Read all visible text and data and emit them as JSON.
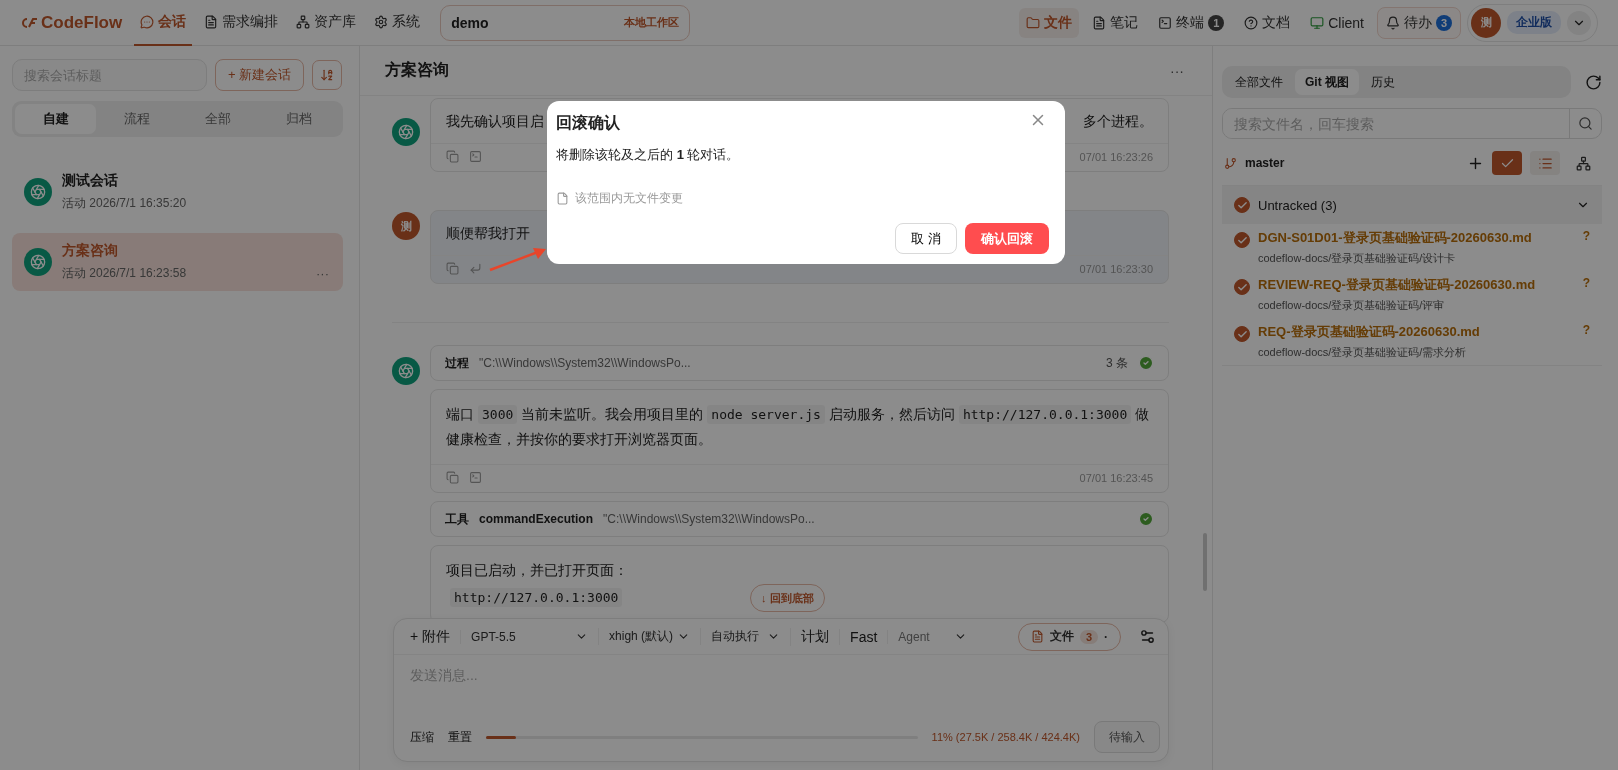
{
  "app": {
    "logo": "CodeFlow"
  },
  "nav": [
    {
      "label": "会话",
      "selected": true
    },
    {
      "label": "需求编排",
      "selected": false
    },
    {
      "label": "资产库",
      "selected": false
    },
    {
      "label": "系统",
      "selected": false
    }
  ],
  "workspace": {
    "name": "demo",
    "tag": "本地工作区"
  },
  "tools": [
    {
      "label": "文件",
      "selected": true
    },
    {
      "label": "笔记",
      "selected": false
    },
    {
      "label": "终端",
      "badge": "1",
      "selected": false
    },
    {
      "label": "文档",
      "selected": false
    },
    {
      "label": "Client",
      "selected": false
    }
  ],
  "todo": {
    "label": "待办",
    "badge": "3"
  },
  "user": {
    "avatar": "测",
    "plan": "企业版"
  },
  "sidebar": {
    "search_placeholder": "搜索会话标题",
    "new_button": "+ 新建会话",
    "tabs": [
      {
        "label": "自建",
        "selected": true
      },
      {
        "label": "流程",
        "selected": false
      },
      {
        "label": "全部",
        "selected": false
      },
      {
        "label": "归档",
        "selected": false
      }
    ],
    "sessions": [
      {
        "title": "测试会话",
        "activity": "活动 2026/7/1 16:35:20",
        "selected": false
      },
      {
        "title": "方案咨询",
        "activity": "活动 2026/7/1 16:23:58",
        "more": "···",
        "selected": true
      }
    ]
  },
  "conversation": {
    "title": "方案咨询",
    "more": "···",
    "rows": [
      {
        "kind": "assistant",
        "blocks": [
          {
            "kind": "clipped",
            "start": "我先确认项目启",
            "end": "多个进程。",
            "time": "07/01 16:23:26"
          }
        ]
      },
      {
        "kind": "user",
        "avatar": "测",
        "blocks": [
          {
            "kind": "clipped",
            "start": "顺便帮我打开",
            "time": "07/01 16:23:30"
          }
        ]
      },
      {
        "kind": "assistant",
        "blocks": [
          {
            "kind": "process",
            "label": "过程",
            "detail": "\"C:\\\\Windows\\\\System32\\\\WindowsPo...",
            "count": "3 条",
            "done": true
          },
          {
            "kind": "text",
            "time": "07/01 16:23:45",
            "paragraphs": [
              {
                "parts": [
                  {
                    "kind": "plain",
                    "text": "端口"
                  },
                  {
                    "kind": "code",
                    "text": "3000"
                  },
                  {
                    "kind": "plain",
                    "text": "当前未监听。我会用项目里的"
                  },
                  {
                    "kind": "code",
                    "text": "node server.js"
                  },
                  {
                    "kind": "plain",
                    "text": "启动服务，然后访问"
                  },
                  {
                    "kind": "code",
                    "text": "http://127.0.0.1:3000"
                  },
                  {
                    "kind": "plain",
                    "text": "做健康检查，并按你的要求打开浏览器页面。"
                  }
                ]
              }
            ]
          },
          {
            "kind": "tool",
            "label": "工具",
            "name": "commandExecution",
            "detail": "\"C:\\\\Windows\\\\System32\\\\WindowsPo...",
            "done": true
          },
          {
            "kind": "text",
            "paragraphs": [
              {
                "parts": [
                  {
                    "kind": "plain",
                    "text": "项目已启动，并已打开页面："
                  }
                ]
              },
              {
                "parts": [
                  {
                    "kind": "code",
                    "text": "http://127.0.0.1:3000"
                  }
                ]
              }
            ]
          }
        ]
      }
    ],
    "jump_button": "↓ 回到底部"
  },
  "composer": {
    "attach": "+ 附件",
    "model": "GPT-5.5",
    "effort": "xhigh (默认)",
    "mode": "自动执行",
    "plan": "计划",
    "fast": "Fast",
    "agent": "Agent",
    "files_label": "文件",
    "files_count": "3",
    "files_more": "·",
    "placeholder": "发送消息...",
    "compress": "压缩",
    "reset": "重置",
    "level": 0.07,
    "usage": "11% (27.5K / 258.4K / 424.4K)",
    "send": "待输入"
  },
  "files_panel": {
    "tabs": [
      {
        "label": "全部文件",
        "selected": false
      },
      {
        "label": "Git 视图",
        "selected": true
      },
      {
        "label": "历史",
        "selected": false
      }
    ],
    "search_placeholder": "搜索文件名，回车搜索",
    "branch": "master",
    "group": {
      "label": "Untracked (3)",
      "checked": true,
      "expanded": true,
      "files": [
        {
          "name": "DGN-S01D01-登录页基础验证码-20260630.md",
          "path": "codeflow-docs/登录页基础验证码/设计卡",
          "status": "?",
          "checked": true
        },
        {
          "name": "REVIEW-REQ-登录页基础验证码-20260630.md",
          "path": "codeflow-docs/登录页基础验证码/评审",
          "status": "?",
          "checked": true
        },
        {
          "name": "REQ-登录页基础验证码-20260630.md",
          "path": "codeflow-docs/登录页基础验证码/需求分析",
          "status": "?",
          "checked": true
        }
      ]
    }
  },
  "dialog": {
    "title": "回滚确认",
    "message": "将删除该轮及之后的 **1** 轮对话。",
    "note": "该范围内无文件变更",
    "cancel": "取 消",
    "confirm": "确认回滚"
  }
}
